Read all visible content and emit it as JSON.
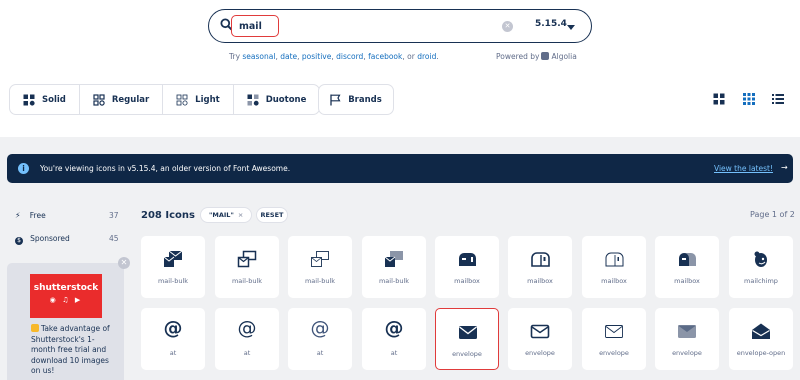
{
  "search": {
    "value": "mail",
    "version": "5.15.4",
    "try_prefix": "Try ",
    "try_links": [
      "seasonal",
      "date",
      "positive",
      "discord",
      "facebook"
    ],
    "try_or": "or",
    "try_last": "droid",
    "powered_by": "Powered by",
    "powered_brand": "Algolia"
  },
  "styles": {
    "items": [
      "Solid",
      "Regular",
      "Light",
      "Duotone"
    ],
    "brands": "Brands"
  },
  "banner": {
    "text": "You're viewing icons in v5.15.4, an older version of Font Awesome.",
    "link": "View the latest!",
    "arrow": "→"
  },
  "sidebar": {
    "items": [
      {
        "label": "Free",
        "count": "37",
        "icon": "bolt-icon"
      },
      {
        "label": "Sponsored",
        "count": "45",
        "icon": "dollar-circle-icon"
      }
    ],
    "ad": {
      "logo": "shutterstock",
      "text": "Take advantage of Shutterstock's 1-month free trial and download 10 images on us!",
      "colors": {
        "logo_bg": "#ea2c2c"
      }
    }
  },
  "results": {
    "count": "208 Icons",
    "chip": "\"MAIL\"",
    "chip_x": "×",
    "reset": "RESET",
    "page": "Page 1 of 2"
  },
  "icons": [
    {
      "label": "mail-bulk",
      "glyph": "mail-bulk-solid"
    },
    {
      "label": "mail-bulk",
      "glyph": "mail-bulk-regular"
    },
    {
      "label": "mail-bulk",
      "glyph": "mail-bulk-light"
    },
    {
      "label": "mail-bulk",
      "glyph": "mail-bulk-duotone"
    },
    {
      "label": "mailbox",
      "glyph": "mailbox-solid"
    },
    {
      "label": "mailbox",
      "glyph": "mailbox-regular"
    },
    {
      "label": "mailbox",
      "glyph": "mailbox-light"
    },
    {
      "label": "mailbox",
      "glyph": "mailbox-duotone"
    },
    {
      "label": "mailchimp",
      "glyph": "mailchimp-brand"
    },
    {
      "label": "at",
      "glyph": "at-solid"
    },
    {
      "label": "at",
      "glyph": "at-regular"
    },
    {
      "label": "at",
      "glyph": "at-light"
    },
    {
      "label": "at",
      "glyph": "at-duotone"
    },
    {
      "label": "envelope",
      "glyph": "envelope-solid",
      "highlighted": true
    },
    {
      "label": "envelope",
      "glyph": "envelope-regular"
    },
    {
      "label": "envelope",
      "glyph": "envelope-light"
    },
    {
      "label": "envelope",
      "glyph": "envelope-duotone"
    },
    {
      "label": "envelope-open",
      "glyph": "envelope-open-solid"
    }
  ],
  "at_symbol": "@",
  "colors": {
    "navy": "#183153",
    "banner": "#0f2746",
    "link": "#146ebe",
    "highlight": "#e03b3b"
  }
}
